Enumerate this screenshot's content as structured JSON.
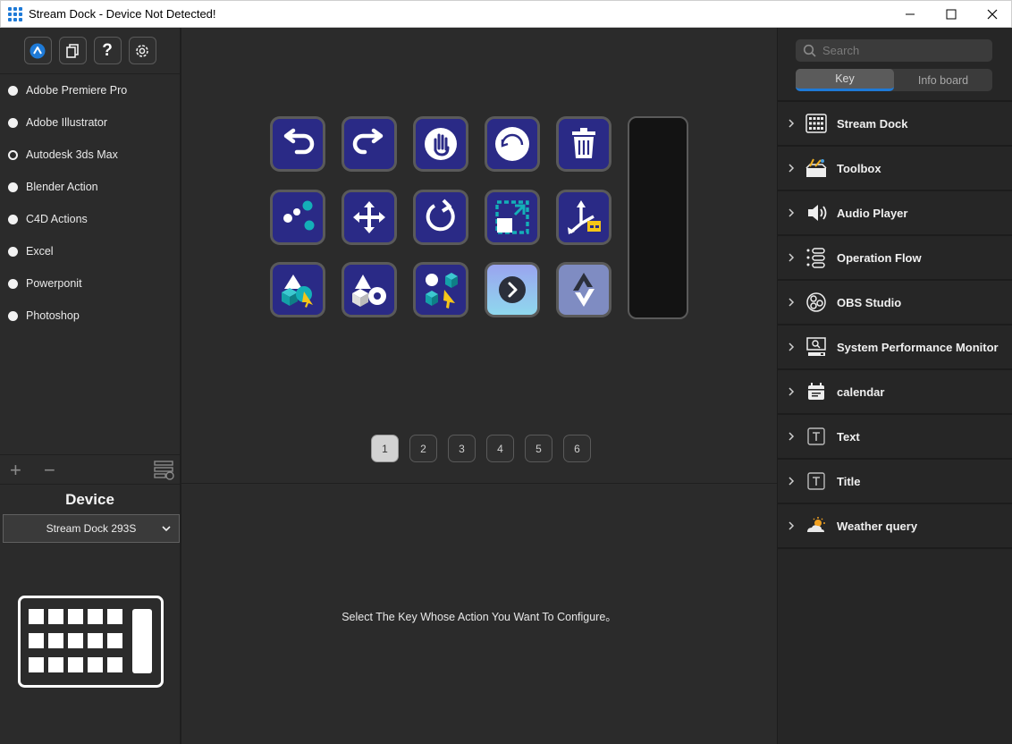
{
  "window": {
    "title": "Stream Dock - Device Not Detected!",
    "minimize_icon": "minimize-icon",
    "maximize_icon": "maximize-icon",
    "close_icon": "close-icon"
  },
  "toolbar": {
    "icons": [
      "store-icon",
      "copy-icon",
      "help-icon",
      "settings-icon"
    ],
    "help_glyph": "?"
  },
  "profiles": [
    {
      "label": "Adobe Premiere Pro",
      "selected": false
    },
    {
      "label": "Adobe Illustrator",
      "selected": false
    },
    {
      "label": "Autodesk 3ds Max",
      "selected": true
    },
    {
      "label": "Blender Action",
      "selected": false
    },
    {
      "label": "C4D Actions",
      "selected": false
    },
    {
      "label": "Excel",
      "selected": false
    },
    {
      "label": "Powerponit",
      "selected": false
    },
    {
      "label": "Photoshop",
      "selected": false
    }
  ],
  "profile_actions": {
    "add_glyph": "+",
    "remove_glyph": "−",
    "manage_icon": "profile-manage-icon"
  },
  "device": {
    "heading": "Device",
    "selected_model": "Stream Dock 293S"
  },
  "keys": [
    {
      "icon": "undo-icon"
    },
    {
      "icon": "redo-icon"
    },
    {
      "icon": "hand-pan-icon"
    },
    {
      "icon": "orbit-icon"
    },
    {
      "icon": "trash-icon"
    },
    {
      "icon": "scatter-dots-icon"
    },
    {
      "icon": "move-arrows-icon"
    },
    {
      "icon": "rotate-icon"
    },
    {
      "icon": "scale-icon"
    },
    {
      "icon": "axis-gizmo-icon"
    },
    {
      "icon": "select-object-icon"
    },
    {
      "icon": "primitives-icon"
    },
    {
      "icon": "select-multiple-icon"
    },
    {
      "icon": "next-page-icon"
    },
    {
      "icon": "up-down-icon"
    }
  ],
  "pages": [
    "1",
    "2",
    "3",
    "4",
    "5",
    "6"
  ],
  "active_page": "1",
  "config_hint": "Select The Key Whose Action You Want To Configure。",
  "search": {
    "placeholder": "Search"
  },
  "tabs": [
    {
      "label": "Key",
      "active": true
    },
    {
      "label": "Info board",
      "active": false
    }
  ],
  "categories": [
    {
      "label": "Stream Dock",
      "icon": "keypad-icon"
    },
    {
      "label": "Toolbox",
      "icon": "toolbox-icon"
    },
    {
      "label": "Audio Player",
      "icon": "speaker-icon"
    },
    {
      "label": "Operation Flow",
      "icon": "flow-icon"
    },
    {
      "label": "OBS Studio",
      "icon": "obs-icon"
    },
    {
      "label": "System Performance Monitor",
      "icon": "monitor-icon"
    },
    {
      "label": "calendar",
      "icon": "calendar-icon"
    },
    {
      "label": "Text",
      "icon": "text-icon"
    },
    {
      "label": "Title",
      "icon": "title-icon"
    },
    {
      "label": "Weather query",
      "icon": "weather-icon"
    }
  ],
  "colors": {
    "accent": "#1e7ad7",
    "key_background": "#2a2a86",
    "panel_background": "#2b2b2b"
  }
}
